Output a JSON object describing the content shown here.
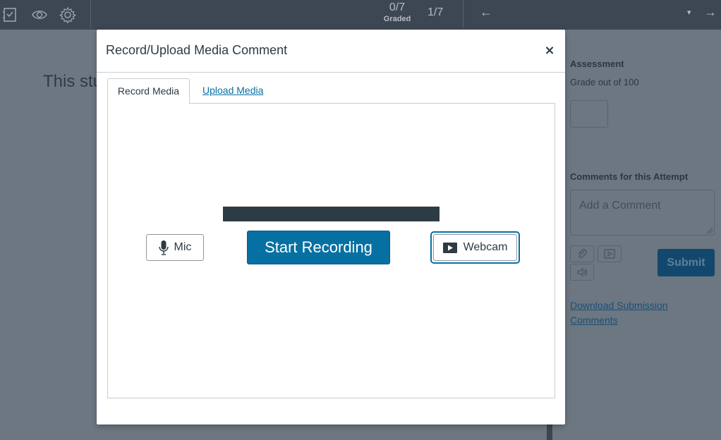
{
  "topbar": {
    "graded_count": "0/7",
    "graded_label": "Graded",
    "position": "1/7",
    "prev_arrow": "←",
    "next_arrow": "→",
    "caret": "▾",
    "icons": [
      "grading-icon",
      "eye-icon",
      "gear-icon"
    ]
  },
  "main": {
    "text": "This stu"
  },
  "right_panel": {
    "assessment_heading": "Assessment",
    "grade_label": "Grade out of 100",
    "comments_heading": "Comments for this Attempt",
    "comment_placeholder": "Add a Comment",
    "submit_label": "Submit",
    "download_link": "Download Submission Comments"
  },
  "modal": {
    "title": "Record/Upload Media Comment",
    "close_label": "×",
    "tabs": [
      {
        "label": "Record Media",
        "active": true
      },
      {
        "label": "Upload Media",
        "active": false
      }
    ],
    "mic_label": "Mic",
    "start_label": "Start Recording",
    "webcam_label": "Webcam"
  },
  "colors": {
    "overlay": "#6c7782",
    "topbar": "#3c4753",
    "primary_button": "#0770a3",
    "text": "#2d3b45"
  }
}
